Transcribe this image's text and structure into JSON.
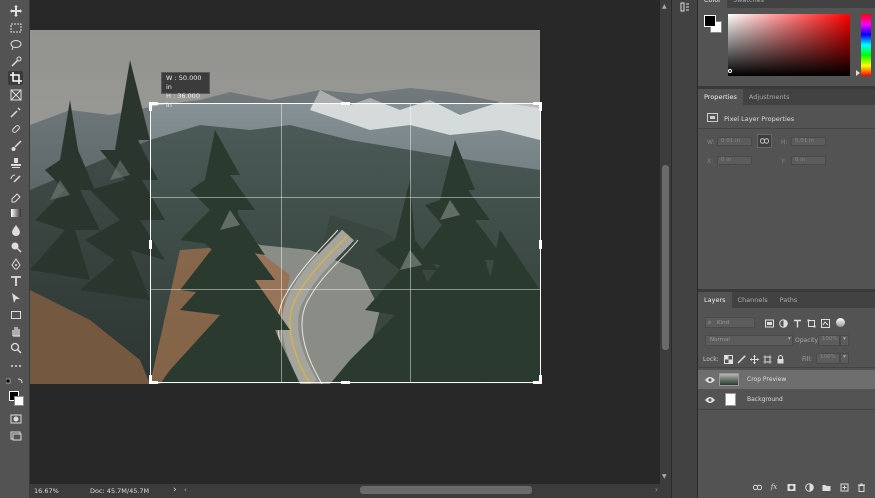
{
  "crop_tooltip": {
    "width": "W : 50.000 in",
    "height": "H : 36.000 in"
  },
  "status": {
    "zoom": "16.67%",
    "doc": "Doc: 45.7M/45.7M",
    "arrow": "›"
  },
  "color_panel": {
    "tabs": [
      "Color",
      "Swatches"
    ],
    "accent": "#ff0000"
  },
  "properties": {
    "tabs": [
      "Properties",
      "Adjustments"
    ],
    "section_title": "Pixel Layer Properties",
    "w_label": "W:",
    "w_value": "0.01 in",
    "h_label": "H:",
    "h_value": "0.01 in",
    "x_label": "X:",
    "x_value": "0 in",
    "y_label": "Y:",
    "y_value": "0 in"
  },
  "layers": {
    "tabs": [
      "Layers",
      "Channels",
      "Paths"
    ],
    "kind_placeholder": "Kind",
    "blend_mode": "Normal",
    "opacity_label": "Opacity:",
    "opacity_value": "100%",
    "lock_label": "Lock:",
    "fill_label": "Fill:",
    "fill_value": "100%",
    "items": [
      {
        "name": "Crop Preview",
        "selected": true
      },
      {
        "name": "Background",
        "selected": false
      }
    ]
  },
  "bottom_icons": [
    "link-icon",
    "fx-icon",
    "mask-icon",
    "adjustment-icon",
    "folder-icon",
    "new-layer-icon",
    "trash-icon"
  ]
}
